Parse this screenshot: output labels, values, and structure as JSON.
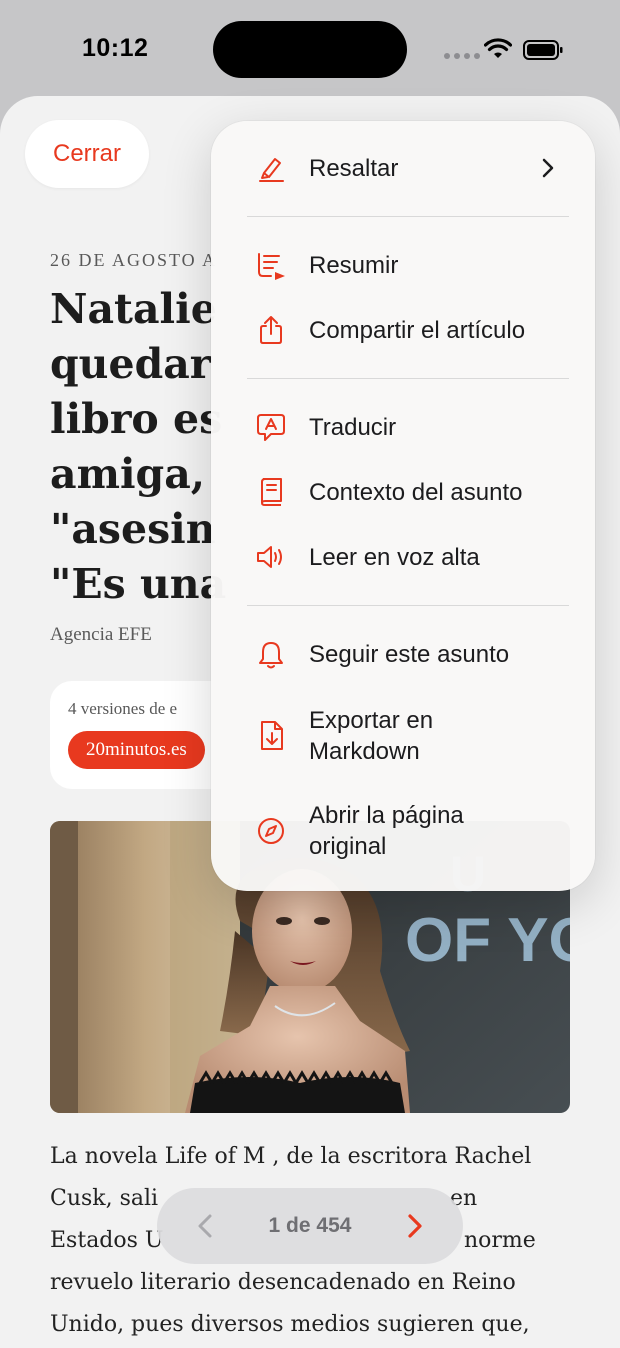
{
  "status_bar": {
    "time": "10:12"
  },
  "header": {
    "close_label": "Cerrar"
  },
  "article": {
    "date": "26 DE AGOSTO A",
    "headline_lines": [
      "Natalie",
      "quedar",
      "libro es",
      "amiga, ",
      "\"asesin",
      "\"Es una"
    ],
    "agency": "Agencia EFE",
    "versions_label": "4 versiones de e",
    "source": "20minutos.es",
    "body_lines": [
      "La novela Life of M , de la escritora Rachel",
      "Cusk, sali",
      "Estados U",
      "revuelo literario desencadenado en Reino",
      "Unido, pues diversos medios sugieren que,"
    ],
    "body_line2_end": "en",
    "body_line3_end": "norme"
  },
  "pager": {
    "label": "1 de 454"
  },
  "menu": {
    "items": [
      {
        "label": "Resaltar",
        "icon": "highlighter-icon"
      },
      {
        "label": "Resumir",
        "icon": "summarize-icon"
      },
      {
        "label": "Compartir el artículo",
        "icon": "share-icon"
      },
      {
        "label": "Traducir",
        "icon": "translate-icon"
      },
      {
        "label": "Contexto del asunto",
        "icon": "book-icon"
      },
      {
        "label": "Leer en voz alta",
        "icon": "speaker-icon"
      },
      {
        "label": "Seguir este asunto",
        "icon": "bell-icon"
      },
      {
        "label_lines": [
          "Exportar en",
          "Markdown"
        ],
        "icon": "export-icon"
      },
      {
        "label_lines": [
          "Abrir la página",
          "original"
        ],
        "icon": "compass-icon"
      }
    ]
  },
  "colors": {
    "accent": "#e8391f",
    "background": "#f2f2f2",
    "menu_bg": "#f9f8f7"
  }
}
